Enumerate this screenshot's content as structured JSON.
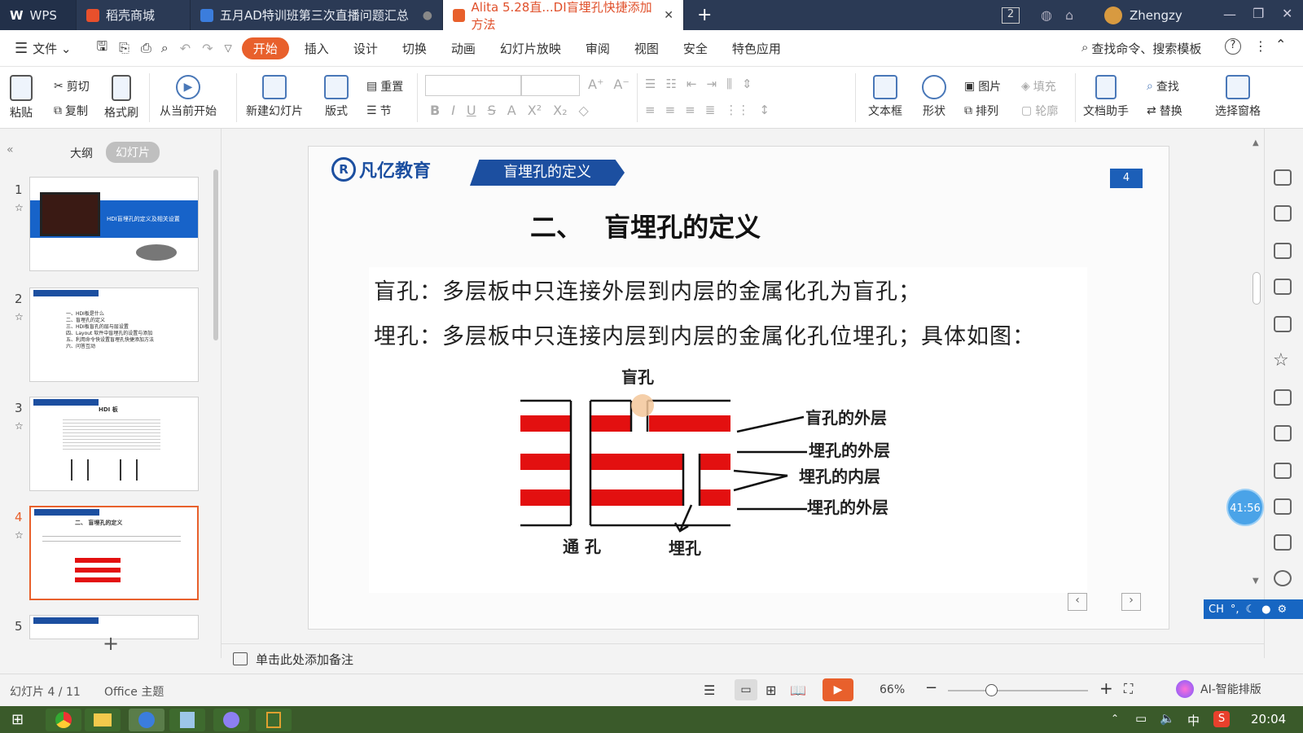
{
  "titlebar": {
    "tabs": [
      {
        "label": "WPS",
        "active": false
      },
      {
        "label": "稻壳商城",
        "active": false
      },
      {
        "label": "五月AD特训班第三次直播问题汇总",
        "active": false
      },
      {
        "label": "Alita 5.28直...DI盲埋孔快捷添加方法",
        "active": true
      }
    ],
    "badge": "2",
    "user": "Zhengzy"
  },
  "menubar": {
    "file": "文件",
    "items": [
      "开始",
      "插入",
      "设计",
      "切换",
      "动画",
      "幻灯片放映",
      "审阅",
      "视图",
      "安全",
      "特色应用"
    ],
    "search": "查找命令、搜索模板"
  },
  "ribbon": {
    "paste": "粘贴",
    "cut": "剪切",
    "copy": "复制",
    "format_painter": "格式刷",
    "from_current": "从当前开始",
    "new_slide": "新建幻灯片",
    "layout": "版式",
    "reset": "重置",
    "section": "节",
    "textbox": "文本框",
    "shape": "形状",
    "picture": "图片",
    "fill": "填充",
    "arrange": "排列",
    "outline": "轮廓",
    "doc_helper": "文档助手",
    "find": "查找",
    "replace": "替换",
    "select_pane": "选择窗格"
  },
  "leftpanel": {
    "tab_outline": "大纲",
    "tab_slides": "幻灯片",
    "slide_numbers": [
      "1",
      "2",
      "3",
      "4",
      "5"
    ],
    "thumb1_title": "HDI盲埋孔的定义及相关设置",
    "thumb2_lines": [
      "一、HDI板是什么",
      "二、盲埋孔的定义",
      "三、HDI板盲孔的层与层设置",
      "四、Layout 软件中盲埋孔的设置与添加",
      "五、利用命令快设置盲埋孔快捷添加方法",
      "六、问答互动"
    ],
    "thumb3_title": "HDI 板",
    "thumb4_title": "二、 盲埋孔的定义"
  },
  "slide": {
    "logo": "凡亿教育",
    "banner": "盲埋孔的定义",
    "page_number": "4",
    "heading": "二、　 盲埋孔的定义",
    "line1": "盲孔：多层板中只连接外层到内层的金属化孔为盲孔；",
    "line2": "埋孔：多层板中只连接内层到内层的金属化孔位埋孔；具体如图：",
    "diagram": {
      "top_label": "盲孔",
      "through_label": "通 孔",
      "buried_label": "埋孔",
      "right_labels": [
        "盲孔的外层",
        "埋孔的外层",
        "埋孔的内层",
        "埋孔的外层"
      ]
    }
  },
  "notes": "单击此处添加备注",
  "timer": "41:56",
  "ime": "CH",
  "statusbar": {
    "slide_info": "幻灯片 4 / 11",
    "theme": "Office 主题",
    "zoom": "66%",
    "ai": "AI-智能排版"
  },
  "taskbar": {
    "ime_lang": "中",
    "clock": "20:04"
  }
}
